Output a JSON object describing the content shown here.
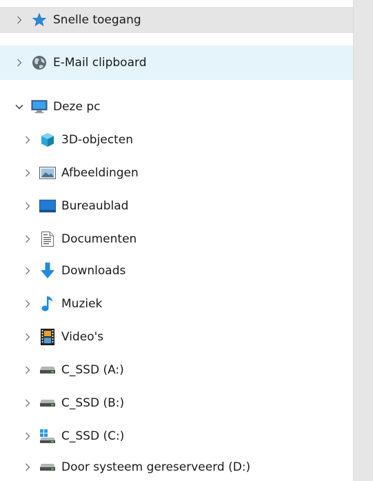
{
  "nav": {
    "quick_access": {
      "label": "Snelle toegang",
      "icon": "star-icon"
    },
    "email_clipboard": {
      "label": "E-Mail clipboard",
      "icon": "globe-icon"
    },
    "this_pc": {
      "label": "Deze pc",
      "icon": "monitor-icon",
      "children": [
        {
          "label": "3D-objecten",
          "icon": "cube-icon"
        },
        {
          "label": "Afbeeldingen",
          "icon": "pictures-icon"
        },
        {
          "label": "Bureaublad",
          "icon": "desktop-icon"
        },
        {
          "label": "Documenten",
          "icon": "document-icon"
        },
        {
          "label": "Downloads",
          "icon": "download-arrow-icon"
        },
        {
          "label": "Muziek",
          "icon": "music-note-icon"
        },
        {
          "label": "Video's",
          "icon": "film-icon"
        },
        {
          "label": "C_SSD (A:)",
          "icon": "drive-icon"
        },
        {
          "label": "C_SSD (B:)",
          "icon": "drive-icon"
        },
        {
          "label": "C_SSD (C:)",
          "icon": "windows-drive-icon"
        },
        {
          "label": "Door systeem gereserveerd (D:)",
          "icon": "drive-icon"
        }
      ]
    }
  },
  "colors": {
    "hover_gray": "#e5e5e5",
    "selected_blue": "#e5f3fb",
    "accent": "#1f8ae0"
  }
}
